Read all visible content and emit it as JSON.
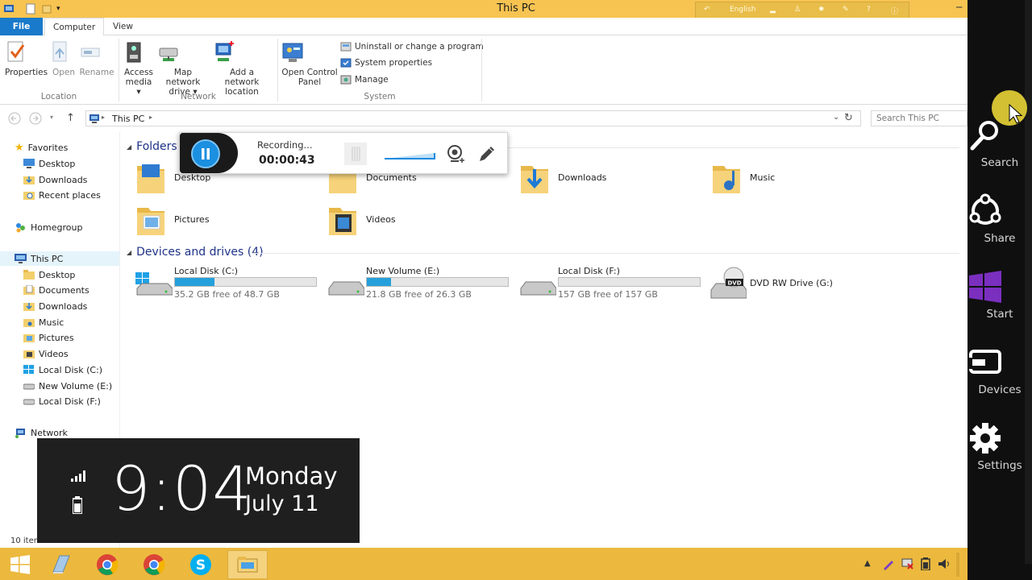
{
  "window": {
    "title": "This PC"
  },
  "toolbar_strip": {
    "language": "English"
  },
  "ribbon": {
    "tabs": [
      {
        "label": "File"
      },
      {
        "label": "Computer"
      },
      {
        "label": "View"
      }
    ],
    "location": {
      "group_label": "Location",
      "properties": "Properties",
      "open": "Open",
      "rename": "Rename"
    },
    "network": {
      "group_label": "Network",
      "access_media": [
        "Access",
        "media ▾"
      ],
      "map_drive": [
        "Map network",
        "drive ▾"
      ],
      "add_location": [
        "Add a network",
        "location"
      ]
    },
    "system": {
      "group_label": "System",
      "control_panel": [
        "Open Control",
        "Panel"
      ],
      "uninstall": "Uninstall or change a program",
      "system_properties": "System properties",
      "manage": "Manage"
    }
  },
  "address": {
    "crumb": "This PC",
    "search_placeholder": "Search This PC"
  },
  "nav": {
    "favorites": "Favorites",
    "fav_items": [
      "Desktop",
      "Downloads",
      "Recent places"
    ],
    "homegroup": "Homegroup",
    "this_pc": "This PC",
    "pc_items": [
      "Desktop",
      "Documents",
      "Downloads",
      "Music",
      "Pictures",
      "Videos",
      "Local Disk (C:)",
      "New Volume (E:)",
      "Local Disk (F:)"
    ],
    "network": "Network"
  },
  "content": {
    "folders_header": "Folders (6)",
    "folders": [
      "Desktop",
      "Documents",
      "Downloads",
      "Music",
      "Pictures",
      "Videos"
    ],
    "drives_header": "Devices and drives (4)",
    "drives": [
      {
        "name": "Local Disk (C:)",
        "free": "35.2 GB free of 48.7 GB",
        "used_fraction": 0.28
      },
      {
        "name": "New Volume (E:)",
        "free": "21.8 GB free of 26.3 GB",
        "used_fraction": 0.17
      },
      {
        "name": "Local Disk (F:)",
        "free": "157 GB free of 157 GB",
        "used_fraction": 0.0
      },
      {
        "name": "DVD RW Drive (G:)"
      }
    ],
    "status": "10 items"
  },
  "recorder": {
    "status": "Recording...",
    "elapsed": "00:00:43"
  },
  "clock": {
    "time": "9:04",
    "day": "Monday",
    "date": "July 11"
  },
  "charms": [
    "Search",
    "Share",
    "Start",
    "Devices",
    "Settings"
  ],
  "colors": {
    "title_bar": "#f7c452",
    "accent": "#1979ca",
    "taskbar": "#ecb93e",
    "start_purple": "#7b2fbf"
  }
}
